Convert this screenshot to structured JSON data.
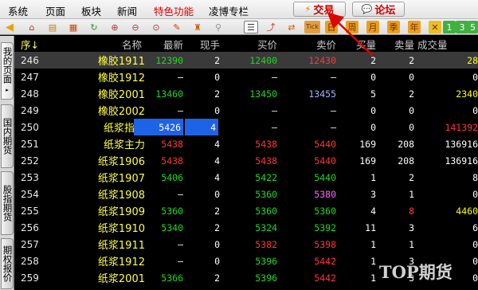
{
  "menubar": {
    "items": [
      {
        "label": "系统",
        "accent": false
      },
      {
        "label": "页面",
        "accent": false
      },
      {
        "label": "板块",
        "accent": false
      },
      {
        "label": "新闻",
        "accent": false
      },
      {
        "label": "特色功能",
        "accent": true
      },
      {
        "label": "凌博专栏",
        "accent": false
      }
    ],
    "trade_button": {
      "label": "交易",
      "icon": "lightning-icon"
    },
    "forum_button": {
      "label": "论坛",
      "icon": "chat-bubble-icon"
    }
  },
  "toolbar": {
    "icons": [
      "back-arrow-icon",
      "home-icon",
      "database-icon",
      "ticker-icon",
      "refresh-icon",
      "zoom-in-icon",
      "zoom-out-icon",
      "zoom-fit-icon",
      "pencil-icon",
      "stamp-icon",
      "pin-icon",
      "list-view-icon",
      "line-chart-icon",
      "chart-toggle-icon",
      "tick-icon",
      "day-icon",
      "week-icon",
      "month-icon",
      "season-icon",
      "year-icon",
      "multi-icon",
      "period-1-icon",
      "period-3-icon",
      "period-5-icon"
    ],
    "labels": {
      "tick": "Tick",
      "day": "日",
      "week": "周",
      "month": "月",
      "season": "季",
      "year": "年",
      "period1": "1",
      "period3": "3",
      "period5": "5"
    }
  },
  "side_tabs": [
    {
      "label": "我的页面",
      "arrow": "▸"
    },
    {
      "label": "国内期货",
      "arrow": ""
    },
    {
      "label": "股指期货",
      "arrow": ""
    },
    {
      "label": "期权报价",
      "arrow": ""
    }
  ],
  "table": {
    "headers": {
      "seq": "序↓",
      "name": "名称",
      "last": "最新",
      "cur_vol": "现手",
      "bid": "买价",
      "ask": "卖价",
      "bid_vol": "买量",
      "ask_vol": "卖量",
      "volume": "成交量"
    },
    "rows": [
      {
        "seq": "246",
        "name": "橡胶1911",
        "last": "12390",
        "cur_vol": "2",
        "bid": "12400",
        "ask": "12430",
        "bid_vol": "2",
        "ask_vol": "2",
        "volume": "28"
      },
      {
        "seq": "247",
        "name": "橡胶1912",
        "last": "—",
        "cur_vol": "0",
        "bid": "—",
        "ask": "—",
        "bid_vol": "0",
        "ask_vol": "0",
        "volume": "0"
      },
      {
        "seq": "248",
        "name": "橡胶2001",
        "last": "13460",
        "cur_vol": "2",
        "bid": "13450",
        "ask": "13455",
        "bid_vol": "5",
        "ask_vol": "2",
        "volume": "2340"
      },
      {
        "seq": "249",
        "name": "橡胶2002",
        "last": "—",
        "cur_vol": "0",
        "bid": "—",
        "ask": "—",
        "bid_vol": "0",
        "ask_vol": "0",
        "volume": "0"
      },
      {
        "seq": "250",
        "name": "纸浆指数",
        "last": "5426",
        "cur_vol": "4",
        "bid": "—",
        "ask": "—",
        "bid_vol": "0",
        "ask_vol": "0",
        "volume": "141392"
      },
      {
        "seq": "251",
        "name": "纸浆主力",
        "last": "5438",
        "cur_vol": "4",
        "bid": "5438",
        "ask": "5440",
        "bid_vol": "169",
        "ask_vol": "208",
        "volume": "136916"
      },
      {
        "seq": "252",
        "name": "纸浆1906",
        "last": "5438",
        "cur_vol": "4",
        "bid": "5438",
        "ask": "5440",
        "bid_vol": "169",
        "ask_vol": "208",
        "volume": "136916"
      },
      {
        "seq": "253",
        "name": "纸浆1907",
        "last": "5406",
        "cur_vol": "4",
        "bid": "5422",
        "ask": "5440",
        "bid_vol": "1",
        "ask_vol": "2",
        "volume": "8"
      },
      {
        "seq": "254",
        "name": "纸浆1908",
        "last": "—",
        "cur_vol": "0",
        "bid": "5360",
        "ask": "5380",
        "bid_vol": "3",
        "ask_vol": "1",
        "volume": "0"
      },
      {
        "seq": "255",
        "name": "纸浆1909",
        "last": "5360",
        "cur_vol": "2",
        "bid": "5360",
        "ask": "5360",
        "bid_vol": "4",
        "ask_vol": "8",
        "volume": "4460"
      },
      {
        "seq": "256",
        "name": "纸浆1910",
        "last": "5340",
        "cur_vol": "2",
        "bid": "5324",
        "ask": "5392",
        "bid_vol": "11",
        "ask_vol": "3",
        "volume": "6"
      },
      {
        "seq": "257",
        "name": "纸浆1911",
        "last": "—",
        "cur_vol": "0",
        "bid": "5382",
        "ask": "5398",
        "bid_vol": "1",
        "ask_vol": "1",
        "volume": "0"
      },
      {
        "seq": "258",
        "name": "纸浆1912",
        "last": "—",
        "cur_vol": "0",
        "bid": "5396",
        "ask": "5442",
        "bid_vol": "1",
        "ask_vol": "3",
        "volume": "0"
      },
      {
        "seq": "259",
        "name": "纸浆2001",
        "last": "5366",
        "cur_vol": "2",
        "bid": "5396",
        "ask": "5442",
        "bid_vol": "1",
        "ask_vol": "3",
        "volume": "0"
      }
    ]
  },
  "colors": {
    "up": "#ff3535",
    "down": "#1ed81e",
    "neutral": "#ffffff",
    "name": "#ffff40",
    "highlight": "#1e63e6",
    "ask_special": "#ff60ff",
    "blue_quote": "#9fb4ff",
    "annotation_arrow": "#e00000"
  },
  "watermark": "TOP期货"
}
